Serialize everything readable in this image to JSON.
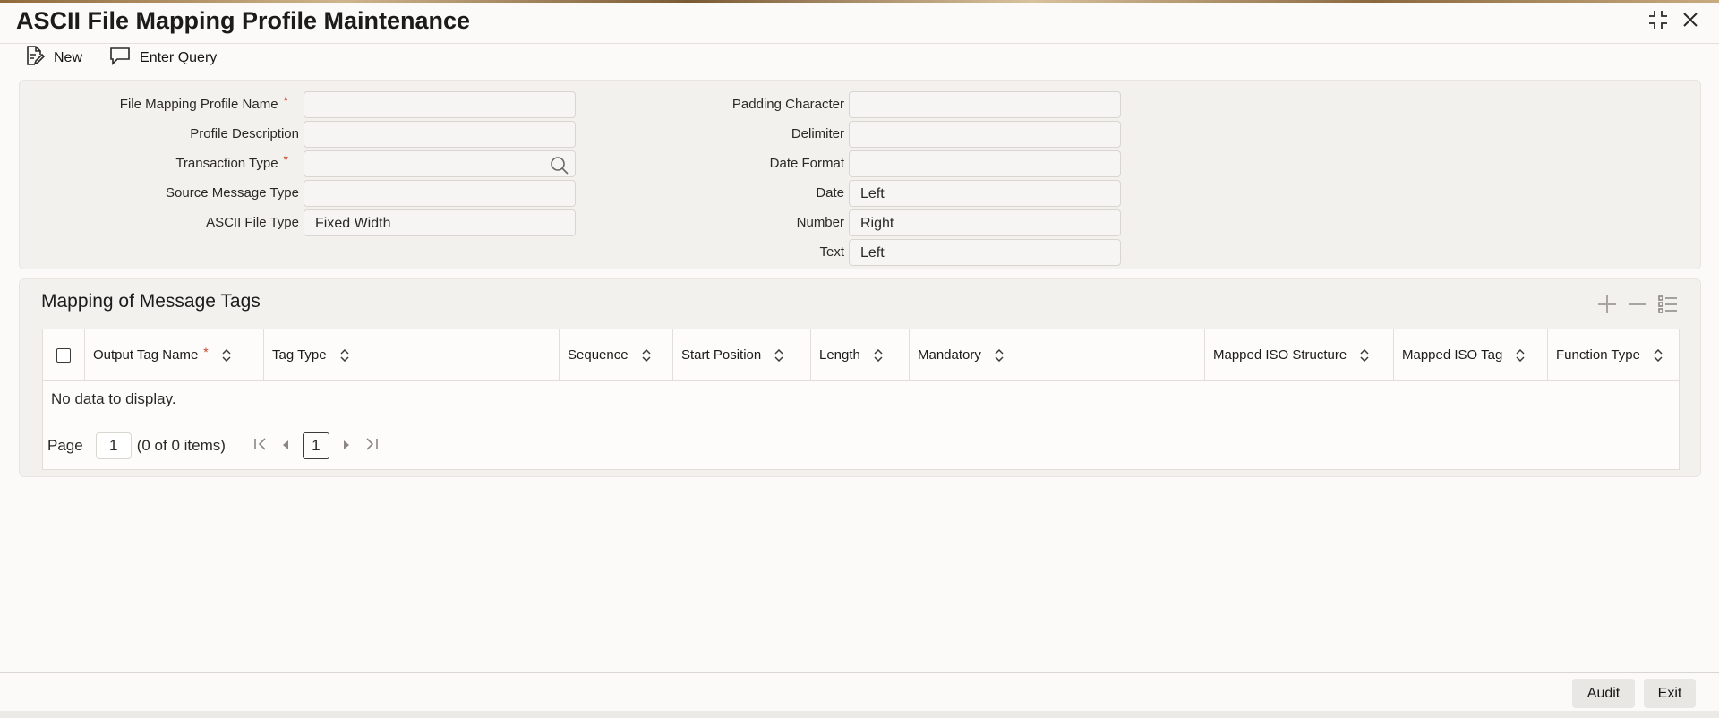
{
  "window": {
    "title": "ASCII File Mapping Profile Maintenance"
  },
  "toolbar": {
    "new_label": "New",
    "enter_query_label": "Enter Query"
  },
  "form": {
    "file_mapping_profile_name": {
      "label": "File Mapping Profile Name",
      "required_mark": "*",
      "value": ""
    },
    "profile_description": {
      "label": "Profile Description",
      "value": ""
    },
    "transaction_type": {
      "label": "Transaction Type",
      "required_mark": "*",
      "value": ""
    },
    "source_message_type": {
      "label": "Source Message Type",
      "value": ""
    },
    "ascii_file_type": {
      "label": "ASCII File Type",
      "value": "Fixed Width"
    },
    "padding_character": {
      "label": "Padding Character",
      "value": ""
    },
    "delimiter": {
      "label": "Delimiter",
      "value": ""
    },
    "date_format": {
      "label": "Date Format",
      "value": ""
    },
    "date": {
      "label": "Date",
      "value": "Left"
    },
    "number": {
      "label": "Number",
      "value": "Right"
    },
    "text": {
      "label": "Text",
      "value": "Left"
    }
  },
  "mapping": {
    "title": "Mapping of Message Tags",
    "columns": [
      {
        "label": "Output Tag Name",
        "required_mark": "*"
      },
      {
        "label": "Tag Type"
      },
      {
        "label": "Sequence"
      },
      {
        "label": "Start Position"
      },
      {
        "label": "Length"
      },
      {
        "label": "Mandatory"
      },
      {
        "label": "Mapped ISO Structure"
      },
      {
        "label": "Mapped ISO Tag"
      },
      {
        "label": "Function Type"
      }
    ],
    "empty_text": "No data to display.",
    "pager": {
      "page_label": "Page",
      "page_value": "1",
      "items_text": "(0 of 0 items)",
      "current_page": "1"
    }
  },
  "footer": {
    "audit_label": "Audit",
    "exit_label": "Exit"
  },
  "icons": {
    "new": "new-record-icon",
    "enter_query": "query-icon",
    "maximize": "collapse-icon",
    "close": "close-icon",
    "search": "search-icon",
    "add_row": "plus-icon",
    "delete_row": "minus-icon",
    "single_view": "list-view-icon",
    "sort": "sort-updown-icon",
    "first": "first-page-icon",
    "prev": "prev-page-icon",
    "next": "next-page-icon",
    "last": "last-page-icon"
  },
  "colors": {
    "required": "#c2452a",
    "background": "#fbfaf8",
    "panel": "#f3f1ee"
  }
}
